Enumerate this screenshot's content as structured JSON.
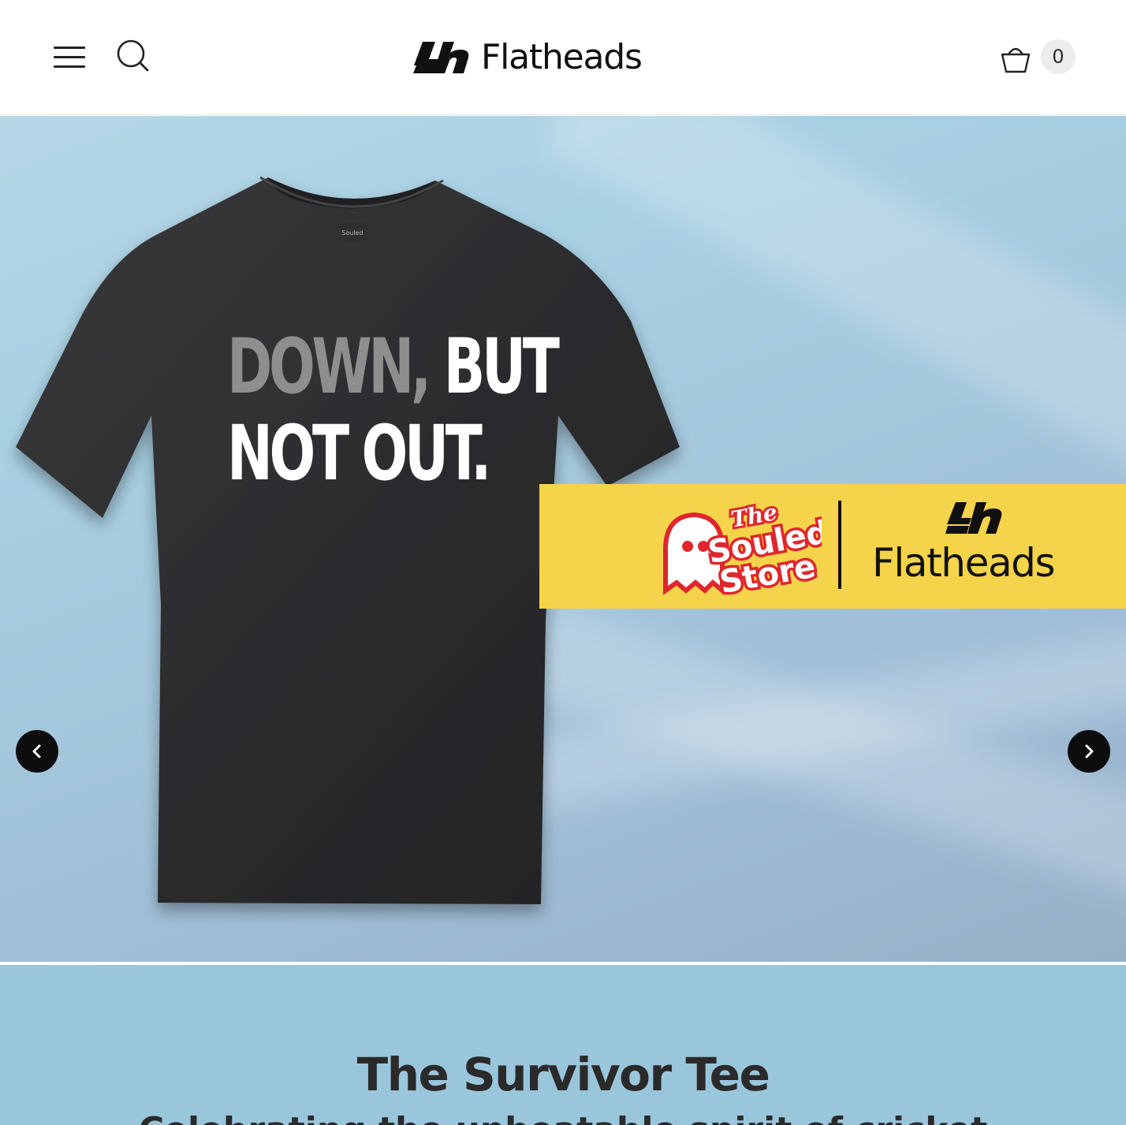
{
  "header": {
    "brand_name": "Flatheads",
    "menu_icon": "hamburger-menu-icon",
    "search_icon": "search-icon",
    "cart_icon": "basket-icon",
    "cart_count": "0"
  },
  "hero": {
    "tee_line1_grey": "DOWN,",
    "tee_line1_white": " BUT",
    "tee_line2": "NOT OUT.",
    "partner_brand": "The Souled Store",
    "partner_brand_line1": "The",
    "partner_brand_line2": "Souled",
    "partner_brand_line3": "Store",
    "banner_brand": "Flatheads",
    "prev_icon": "chevron-left-icon",
    "next_icon": "chevron-right-icon"
  },
  "product": {
    "title": "The Survivor Tee",
    "subtitle": "Celebrating the unbeatable spirit of cricket"
  },
  "colors": {
    "banner_yellow": "#f5d34a",
    "info_background": "#9ac6dc",
    "tee_color": "#2b2b2d",
    "souled_red": "#e0262c"
  }
}
